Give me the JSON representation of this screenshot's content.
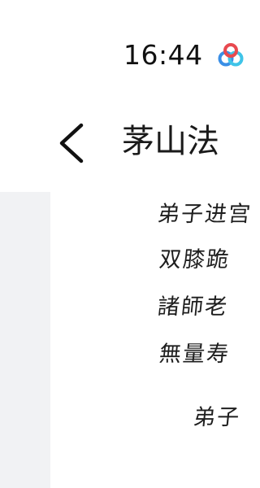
{
  "status_bar": {
    "time": "16:44",
    "app_icon": "colorful-rings-icon"
  },
  "nav_bar": {
    "back_icon": "chevron-left-icon",
    "title": "茅山法"
  },
  "document": {
    "lines": [
      "弟子进宫",
      "双膝跪",
      "諸師老",
      "無量寿",
      "弟子"
    ]
  },
  "colors": {
    "background": "#ffffff",
    "content_background": "#f1f2f4",
    "text": "#1a1a1a",
    "ring_blue": "#3a8fe6",
    "ring_cyan": "#3fc4e8",
    "ring_red": "#e8494f"
  }
}
